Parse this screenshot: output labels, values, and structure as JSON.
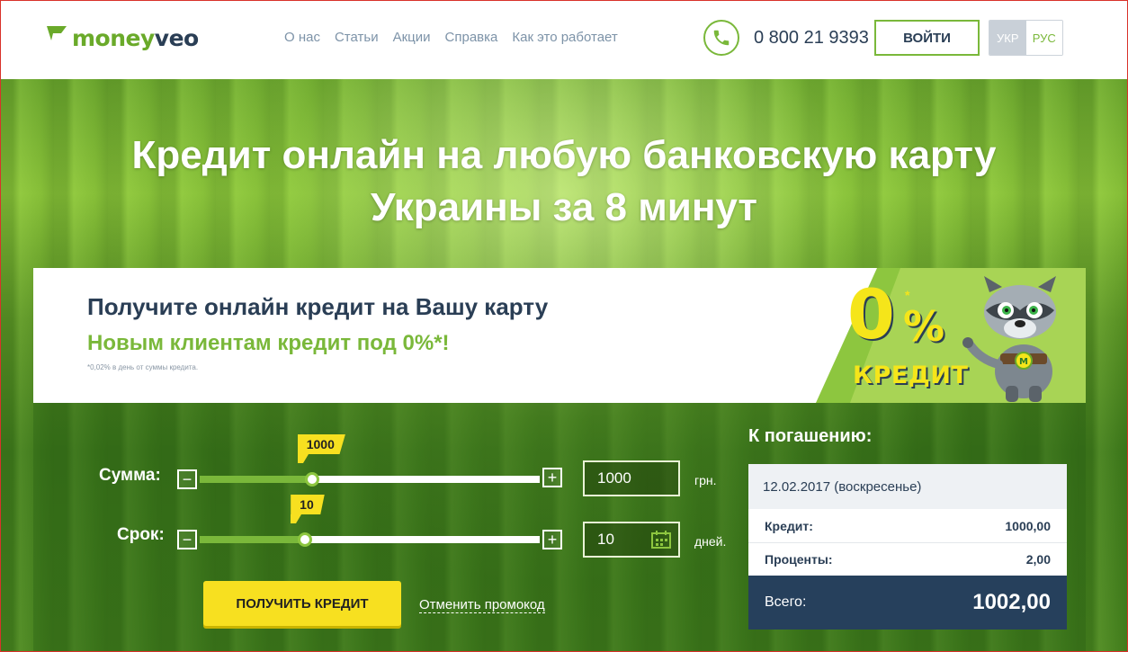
{
  "brand": {
    "name_part1": "money",
    "name_part2": "veo"
  },
  "nav": [
    {
      "label": "О нас"
    },
    {
      "label": "Статьи"
    },
    {
      "label": "Акции"
    },
    {
      "label": "Справка"
    },
    {
      "label": "Как это работает"
    }
  ],
  "header": {
    "phone": "0 800 21 9393",
    "login_label": "ВОЙТИ",
    "lang_ukr": "УКР",
    "lang_rus": "РУС"
  },
  "hero": {
    "title_line1": "Кредит онлайн на любую банковскую карту",
    "title_line2": "Украины за 8 минут"
  },
  "promo": {
    "title": "Получите онлайн кредит на Вашу карту",
    "subtitle": "Новым клиентам кредит под 0%*!",
    "note": "*0,02% в день от суммы кредита.",
    "badge_zero": "0",
    "badge_percent": "%",
    "badge_star": "*",
    "badge_word": "КРЕДИТ"
  },
  "calculator": {
    "amount": {
      "label": "Сумма:",
      "flag_value": "1000",
      "input_value": "1000",
      "unit": "грн.",
      "fill_fraction": 0.33
    },
    "term": {
      "label": "Срок:",
      "flag_value": "10",
      "input_value": "10",
      "unit": "дней.",
      "fill_fraction": 0.31
    },
    "minus": "−",
    "plus": "+",
    "get_credit_label": "ПОЛУЧИТЬ КРЕДИТ",
    "cancel_promo_label": "Отменить промокод"
  },
  "summary": {
    "title": "К погашению:",
    "date": "12.02.2017 (воскресенье)",
    "credit_label": "Кредит:",
    "credit_value": "1000,00",
    "interest_label": "Проценты:",
    "interest_value": "2,00",
    "total_label": "Всего:",
    "total_value": "1002,00"
  },
  "colors": {
    "brand_green": "#7ab83a",
    "navy": "#2a3e55",
    "accent_yellow": "#f7e020"
  }
}
